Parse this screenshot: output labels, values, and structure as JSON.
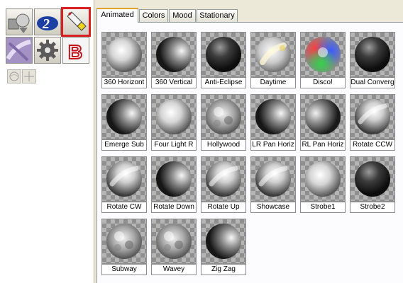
{
  "tabs": [
    {
      "label": "Animated",
      "active": true
    },
    {
      "label": "Colors",
      "active": false
    },
    {
      "label": "Mood",
      "active": false
    },
    {
      "label": "Stationary",
      "active": false
    }
  ],
  "tools": [
    {
      "name": "cube-sphere-tool",
      "selected": false
    },
    {
      "name": "blue-logo-tool",
      "selected": false
    },
    {
      "name": "flashlight-tool",
      "selected": true
    },
    {
      "name": "purple-texture-tool",
      "selected": false
    },
    {
      "name": "gear-tool",
      "selected": false
    },
    {
      "name": "bevel-b-tool",
      "selected": false
    }
  ],
  "swatches": [
    {
      "label": "360 Horizont",
      "style": "bright"
    },
    {
      "label": "360 Vertical",
      "style": "dark-left"
    },
    {
      "label": "Anti-Eclipse",
      "style": "dark"
    },
    {
      "label": "Daytime",
      "style": "daytime"
    },
    {
      "label": "Disco!",
      "style": "disco"
    },
    {
      "label": "Dual Converg",
      "style": "dark"
    },
    {
      "label": "Emerge Sub",
      "style": "dark-left"
    },
    {
      "label": "Four Light R",
      "style": "bright"
    },
    {
      "label": "Hollywood",
      "style": "mottled"
    },
    {
      "label": "LR Pan Horiz",
      "style": "dark-left"
    },
    {
      "label": "RL Pan Horiz",
      "style": "dark-right"
    },
    {
      "label": "Rotate CCW",
      "style": "streak"
    },
    {
      "label": "Rotate CW",
      "style": "streak"
    },
    {
      "label": "Rotate Down",
      "style": "dark-left"
    },
    {
      "label": "Rotate Up",
      "style": "streak"
    },
    {
      "label": "Showcase",
      "style": "streak"
    },
    {
      "label": "Strobe1",
      "style": "bright"
    },
    {
      "label": "Strobe2",
      "style": "dark"
    },
    {
      "label": "Subway",
      "style": "mottled"
    },
    {
      "label": "Wavey",
      "style": "mottled"
    },
    {
      "label": "Zig Zag",
      "style": "dark-left"
    }
  ]
}
